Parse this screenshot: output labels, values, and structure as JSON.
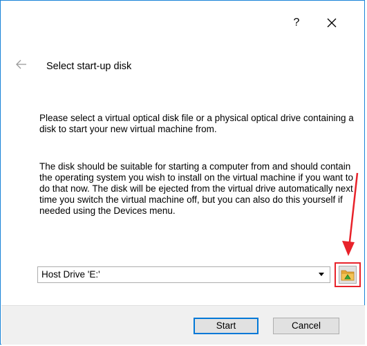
{
  "window": {
    "help_label": "?",
    "close_icon": "close-icon"
  },
  "header": {
    "back_icon": "back-arrow-icon",
    "title": "Select start-up disk"
  },
  "body": {
    "paragraph1": "Please select a virtual optical disk file or a physical optical drive containing a disk to start your new virtual machine from.",
    "paragraph2": "The disk should be suitable for starting a computer from and should contain the operating system you wish to install on the virtual machine if you want to do that now. The disk will be ejected from the virtual drive automatically next time you switch the virtual machine off, but you can also do this yourself if needed using the Devices menu."
  },
  "disk_selector": {
    "selected_value": "Host Drive 'E:'",
    "browse_icon": "folder-icon"
  },
  "annotation": {
    "color": "#e8222a",
    "arrow_icon": "red-arrow-icon"
  },
  "footer": {
    "start_label": "Start",
    "cancel_label": "Cancel"
  },
  "colors": {
    "accent": "#0078d7",
    "window_border": "#1883d7",
    "footer_bg": "#f0f0f0"
  }
}
